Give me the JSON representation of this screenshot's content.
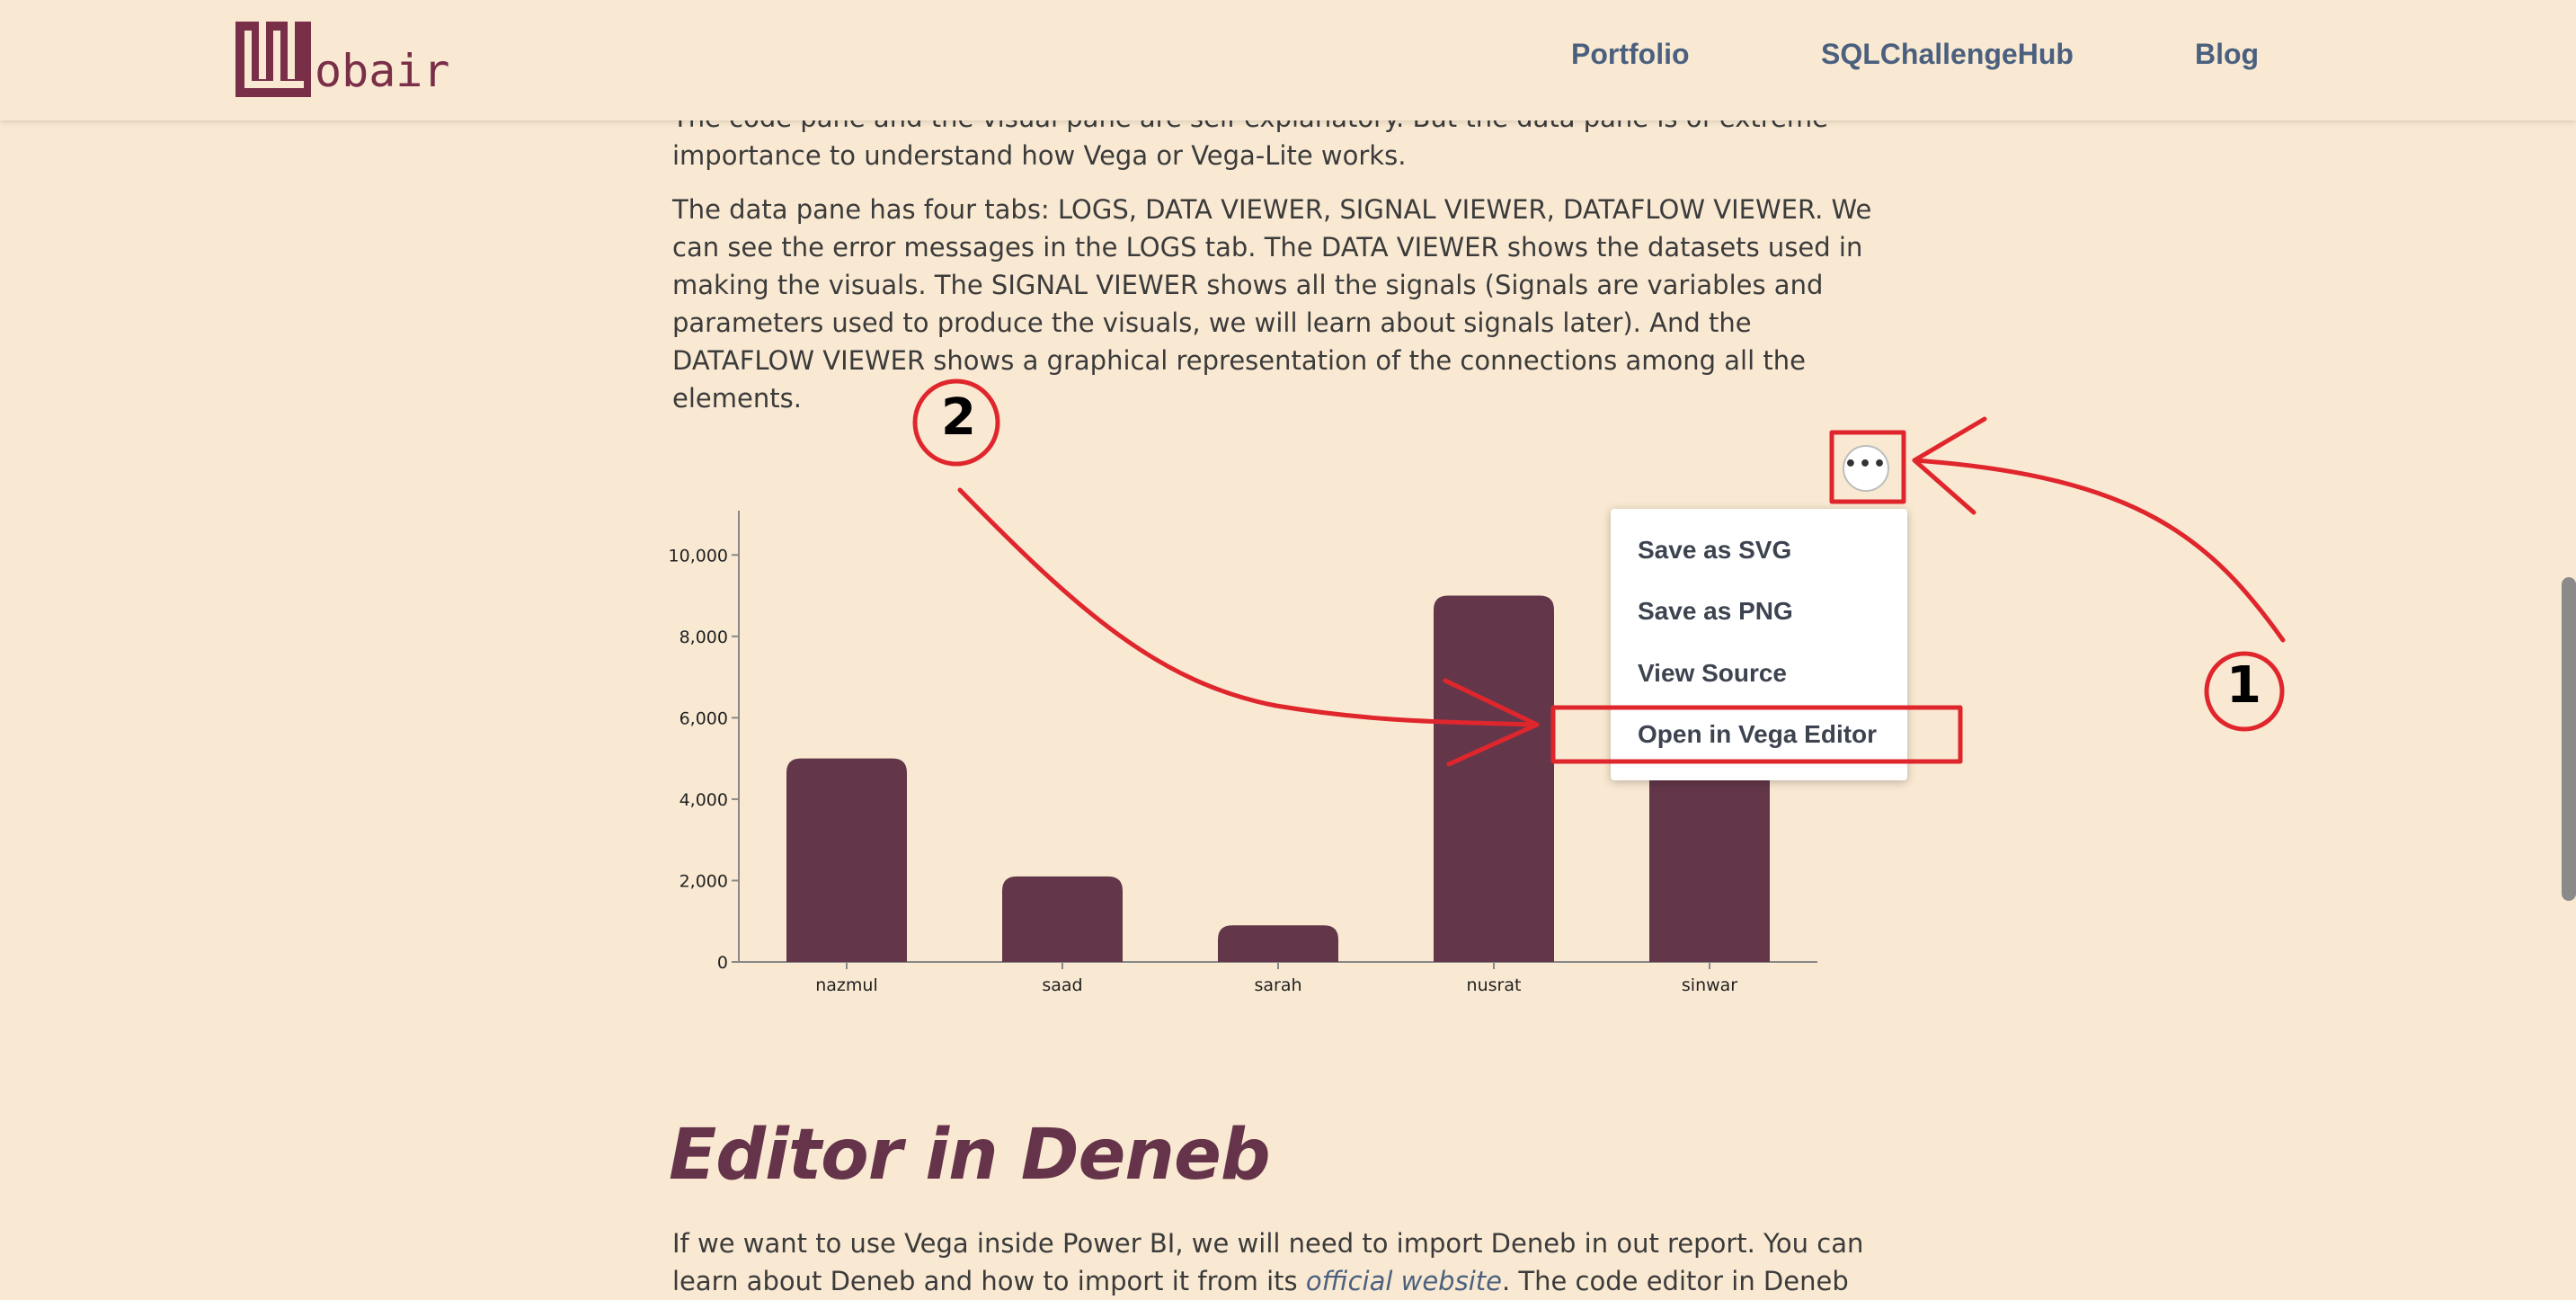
{
  "header": {
    "logo_text": "obair",
    "nav": [
      "Portfolio",
      "SQLChallengeHub",
      "Blog"
    ]
  },
  "article": {
    "para_top": "The code pane and the visual pane are self-explanatory. But the data pane is of extreme importance to understand how Vega or Vega-Lite works.",
    "para_data": "The data pane has four tabs: LOGS, DATA VIEWER, SIGNAL VIEWER, DATAFLOW VIEWER. We can see the error messages in the LOGS tab. The DATA VIEWER shows the datasets used in making the visuals. The SIGNAL VIEWER shows all the signals (Signals are variables and parameters used to produce the visuals, we will learn about signals later). And the DATAFLOW VIEWER shows a graphical representation of the connections among all the elements.",
    "section_heading": "Editor in Deneb",
    "para_deneb_pre": "If we want to use Vega inside Power BI, we will need to import Deneb in out report. You can learn about Deneb and how to import it from its ",
    "para_deneb_link": "official website",
    "para_deneb_post": ". The code editor in Deneb"
  },
  "chart_data": {
    "type": "bar",
    "categories": [
      "nazmul",
      "saad",
      "sarah",
      "nusrat",
      "sinwar"
    ],
    "values": [
      5000,
      2100,
      900,
      9000,
      4800
    ],
    "ylim": [
      0,
      11000
    ],
    "yticks": [
      0,
      2000,
      4000,
      6000,
      8000,
      10000
    ],
    "ytick_labels": [
      "0",
      "2,000",
      "4,000",
      "6,000",
      "8,000",
      "10,000"
    ],
    "bar_color": "#633749",
    "grid": false
  },
  "action_menu": {
    "button_label": "•••",
    "items": [
      "Save as SVG",
      "Save as PNG",
      "View Source",
      "Open in Vega Editor"
    ]
  },
  "annotations": {
    "labels": [
      "1",
      "2"
    ],
    "color": "#e0262d"
  }
}
